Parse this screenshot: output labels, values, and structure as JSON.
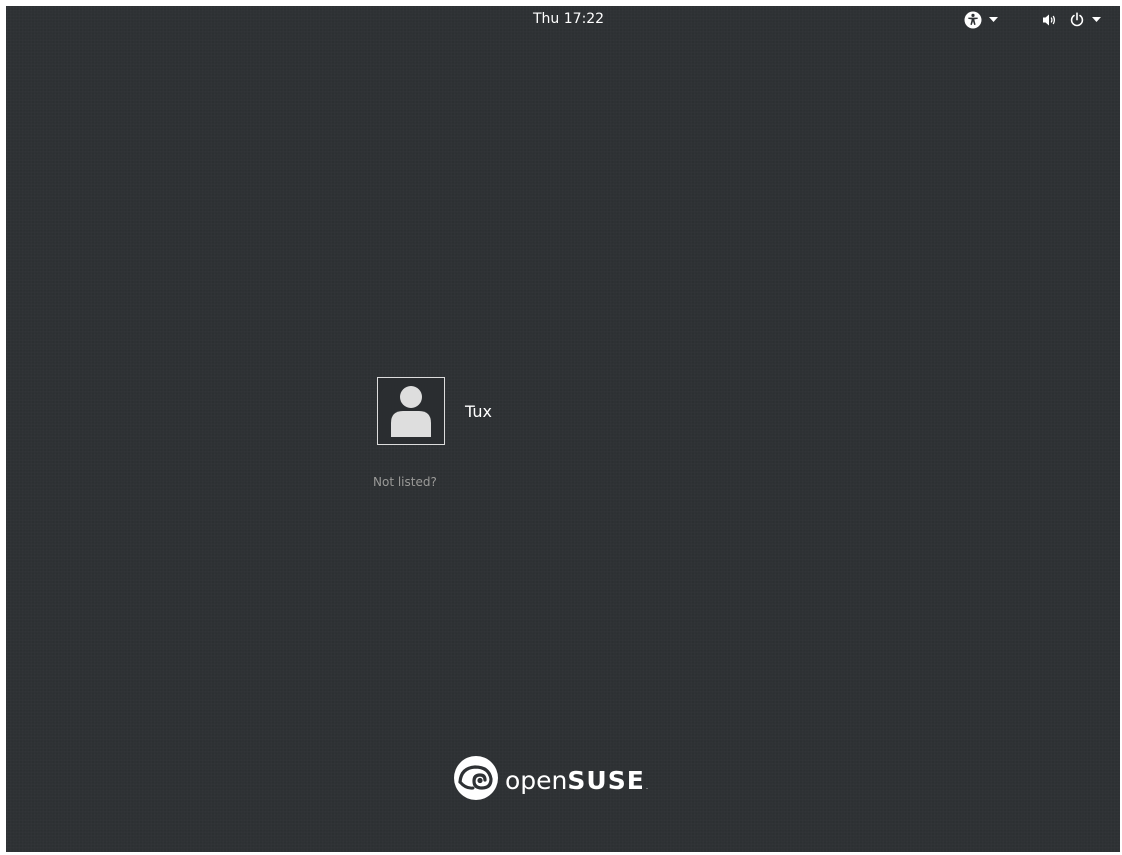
{
  "topbar": {
    "clock": "Thu 17:22",
    "accessibility_menu": {
      "icon": "accessibility-icon",
      "dropdown_icon": "caret-down-icon"
    },
    "system_menu": {
      "volume_icon": "volume-icon",
      "power_icon": "power-icon",
      "dropdown_icon": "caret-down-icon"
    }
  },
  "login": {
    "users": [
      {
        "name": "Tux",
        "avatar_icon": "user-avatar-icon"
      }
    ],
    "not_listed_label": "Not listed?"
  },
  "branding": {
    "logo_icon": "opensuse-chameleon-icon",
    "logo_text_light": "open",
    "logo_text_bold": "SUSE",
    "logo_suffix": "."
  },
  "colors": {
    "background": "#2e3134",
    "text": "#ffffff",
    "muted_text": "#9a9a98",
    "avatar_border": "#dcdcdc"
  }
}
